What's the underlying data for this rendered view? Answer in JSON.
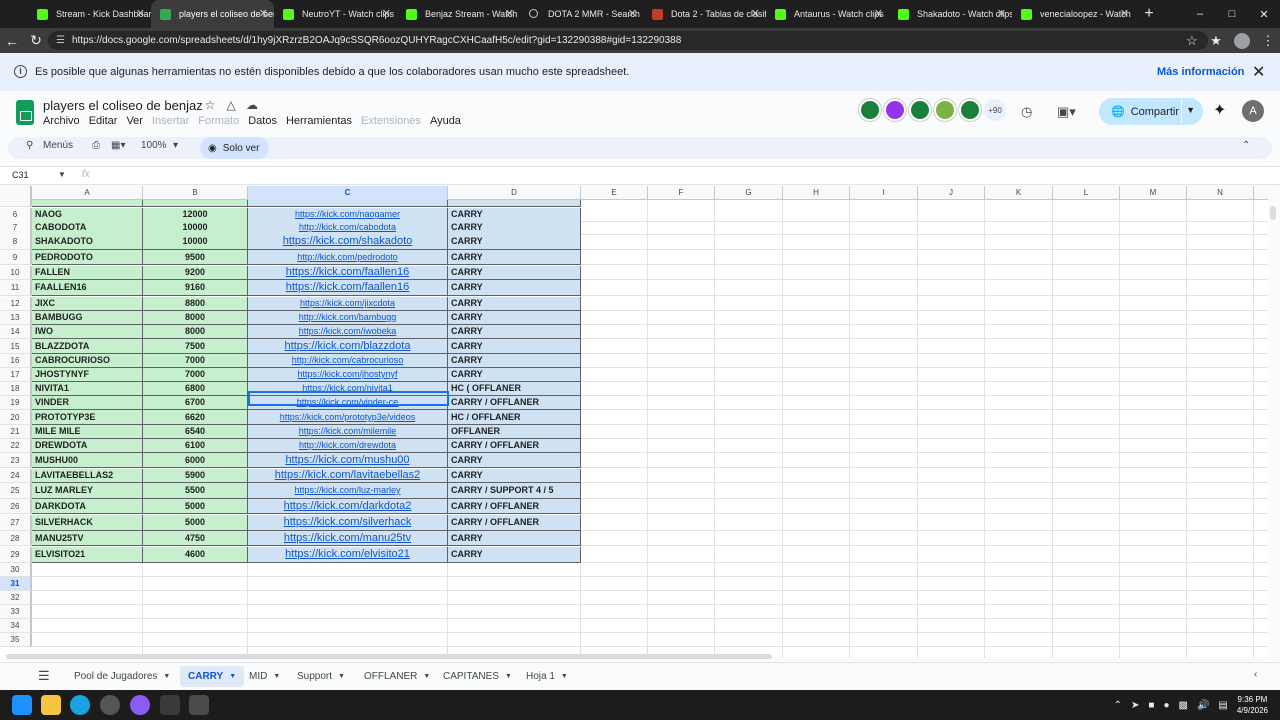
{
  "browser": {
    "tabs": [
      {
        "label": "Stream - Kick Dashboard",
        "kind": "kick"
      },
      {
        "label": "players el coliseo de benjaz",
        "kind": "sheets",
        "active": true
      },
      {
        "label": "NeutroYT - Watch clips",
        "kind": "kick"
      },
      {
        "label": "Benjaz Stream - Watch",
        "kind": "kick"
      },
      {
        "label": "DOTA 2 MMR - Search",
        "kind": "search"
      },
      {
        "label": "Dota 2 - Tablas de clasif",
        "kind": "dota"
      },
      {
        "label": "Antaurus - Watch clips",
        "kind": "kick"
      },
      {
        "label": "Shakadoto - Watch clips",
        "kind": "kick"
      },
      {
        "label": "venecialoopez - Watch",
        "kind": "kick"
      }
    ],
    "url": "https://docs.google.com/spreadsheets/d/1hy9jXRzrzB2OAJq9cSSQR6oozQUHYRagcCXHCaafH5c/edit?gid=132290388#gid=132290388"
  },
  "banner": {
    "message": "Es posible que algunas herramientas no estén disponibles debido a que los colaboradores usan mucho este spreadsheet.",
    "link": "Más información"
  },
  "doc": {
    "title": "players el coliseo de benjaz",
    "menus": [
      {
        "label": "Archivo",
        "disabled": false
      },
      {
        "label": "Editar",
        "disabled": false
      },
      {
        "label": "Ver",
        "disabled": false
      },
      {
        "label": "Insertar",
        "disabled": true
      },
      {
        "label": "Formato",
        "disabled": true
      },
      {
        "label": "Datos",
        "disabled": false
      },
      {
        "label": "Herramientas",
        "disabled": false
      },
      {
        "label": "Extensiones",
        "disabled": true
      },
      {
        "label": "Ayuda",
        "disabled": false
      }
    ],
    "collaborators_more": "+90",
    "share_label": "Compartir",
    "user_initial": "A"
  },
  "toolbar": {
    "menus_label": "Menús",
    "zoom": "100%",
    "view_mode": "Solo ver"
  },
  "formula_bar": {
    "cell_ref": "C31",
    "fx": "fx"
  },
  "columns": [
    "A",
    "B",
    "C",
    "D",
    "E",
    "F",
    "G",
    "H",
    "I",
    "J",
    "K",
    "L",
    "M",
    "N"
  ],
  "selected_column": "C",
  "selected_row": 31,
  "rows": [
    {
      "n": 6,
      "name": "NAOG",
      "mmr": "12000",
      "link": "https://kick.com/naogamer",
      "role": "CARRY",
      "big": false
    },
    {
      "n": 7,
      "name": "CABODOTA",
      "mmr": "10000",
      "link": "http://kick.com/cabodota",
      "role": "CARRY",
      "big": false
    },
    {
      "n": 8,
      "name": "SHAKADOTO",
      "mmr": "10000",
      "link": "https://kick.com/shakadoto",
      "role": "CARRY",
      "big": true
    },
    {
      "n": 9,
      "name": "PEDRODOTO",
      "mmr": "9500",
      "link": "http://kick.com/pedrodoto",
      "role": "CARRY",
      "big": false
    },
    {
      "n": 10,
      "name": "FALLEN",
      "mmr": "9200",
      "link": "https://kick.com/faallen16",
      "role": "CARRY",
      "big": true
    },
    {
      "n": 11,
      "name": "FAALLEN16",
      "mmr": "9160",
      "link": "https://kick.com/faallen16",
      "role": "CARRY",
      "big": true
    },
    {
      "n": 12,
      "name": "JIXC",
      "mmr": "8800",
      "link": "https://kick.com/jixcdota",
      "role": "CARRY",
      "big": false
    },
    {
      "n": 13,
      "name": "BAMBUGG",
      "mmr": "8000",
      "link": "http://kick.com/bambugg",
      "role": "CARRY",
      "big": false
    },
    {
      "n": 14,
      "name": "IWO",
      "mmr": "8000",
      "link": "https://kick.com/iwobeka",
      "role": "CARRY",
      "big": false
    },
    {
      "n": 15,
      "name": "BLAZZDOTA",
      "mmr": "7500",
      "link": "https://kick.com/blazzdota",
      "role": "CARRY",
      "big": true
    },
    {
      "n": 16,
      "name": "CABROCURIOSO",
      "mmr": "7000",
      "link": "http://kick.com/cabrocurioso",
      "role": "CARRY",
      "big": false
    },
    {
      "n": 17,
      "name": "JHOSTYNYF",
      "mmr": "7000",
      "link": "https://kick.com/jhostynyf",
      "role": "CARRY",
      "big": false
    },
    {
      "n": 18,
      "name": "NIVITA1",
      "mmr": "6800",
      "link": "https://kick.com/nivita1",
      "role": "HC ( OFFLANER",
      "big": false
    },
    {
      "n": 19,
      "name": "VINDER",
      "mmr": "6700",
      "link": "https://kick.com/vinder-ce",
      "role": "CARRY / OFFLANER",
      "big": false
    },
    {
      "n": 20,
      "name": "PROTOTYP3E",
      "mmr": "6620",
      "link": "https://kick.com/prototyp3e/videos",
      "role": "HC / OFFLANER",
      "big": false
    },
    {
      "n": 21,
      "name": "MILE MILE",
      "mmr": "6540",
      "link": "https://kick.com/milemile",
      "role": "OFFLANER",
      "big": false
    },
    {
      "n": 22,
      "name": "DREWDOTA",
      "mmr": "6100",
      "link": "http://kick.com/drewdota",
      "role": "CARRY / OFFLANER",
      "big": false
    },
    {
      "n": 23,
      "name": "MUSHU00",
      "mmr": "6000",
      "link": "https://kick.com/mushu00",
      "role": "CARRY",
      "big": true
    },
    {
      "n": 24,
      "name": "LAVITAEBELLAS2",
      "mmr": "5900",
      "link": "https://kick.com/lavitaebellas2",
      "role": "CARRY",
      "big": true
    },
    {
      "n": 25,
      "name": "LUZ MARLEY",
      "mmr": "5500",
      "link": "https://kick.com/luz-marley",
      "role": "CARRY / SUPPORT 4 / 5",
      "big": false
    },
    {
      "n": 26,
      "name": "DARKDOTA",
      "mmr": "5000",
      "link": "https://kick.com/darkdota2",
      "role": "CARRY / OFFLANER",
      "big": true
    },
    {
      "n": 27,
      "name": "SILVERHACK",
      "mmr": "5000",
      "link": "https://kick.com/silverhack",
      "role": "CARRY / OFFLANER",
      "big": true
    },
    {
      "n": 28,
      "name": "MANU25TV",
      "mmr": "4750",
      "link": "https://kick.com/manu25tv",
      "role": "CARRY",
      "big": true
    },
    {
      "n": 29,
      "name": "ELVISITO21",
      "mmr": "4600",
      "link": "https://kick.com/elvisito21",
      "role": "CARRY",
      "big": true
    }
  ],
  "empty_rows": [
    30,
    31,
    32,
    33,
    34,
    35
  ],
  "sheet_tabs": [
    {
      "label": "Pool de Jugadores",
      "active": false
    },
    {
      "label": "CARRY",
      "active": true
    },
    {
      "label": "MID",
      "active": false
    },
    {
      "label": "Support",
      "active": false
    },
    {
      "label": "OFFLANER",
      "active": false
    },
    {
      "label": "CAPITANES",
      "active": false
    },
    {
      "label": "Hoja 1",
      "active": false
    }
  ],
  "taskbar": {
    "time": "9:36 PM",
    "date": "4/9/2026"
  }
}
